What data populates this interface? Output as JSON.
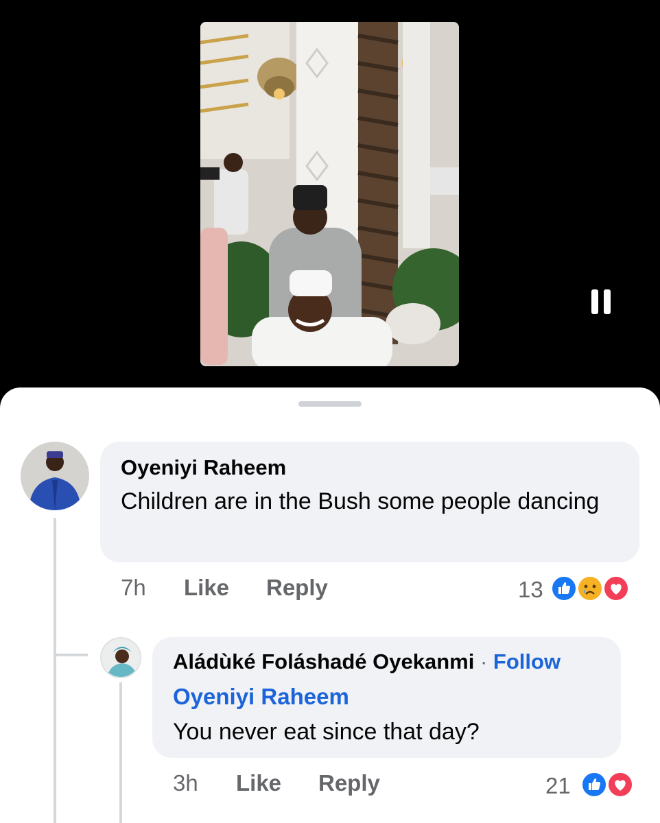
{
  "video": {
    "state_icon": "pause-icon",
    "frame_description": ""
  },
  "comments": [
    {
      "author": "Oyeniyi Raheem",
      "text": "Children are in the Bush some people dancing",
      "time": "7h",
      "like_label": "Like",
      "reply_label": "Reply",
      "reaction_count": "13",
      "reactions": [
        "like-reaction-icon",
        "sad-reaction-icon",
        "love-reaction-icon"
      ]
    }
  ],
  "reply": {
    "author": "Aládùké Foláshadé Oyekanmi",
    "separator": "·",
    "follow_label": "Follow",
    "mention": "Oyeniyi Raheem",
    "text": "You never eat since that day?",
    "time": "3h",
    "like_label": "Like",
    "reply_label": "Reply",
    "reaction_count": "21",
    "reactions": [
      "like-reaction-icon",
      "love-reaction-icon"
    ]
  },
  "colors": {
    "link_blue": "#1c64d9",
    "like_blue": "#1877f2",
    "love_red": "#f33e58",
    "sad_yellow": "#f7b125",
    "meta_gray": "#65676b",
    "bubble_bg": "#f0f2f5"
  }
}
